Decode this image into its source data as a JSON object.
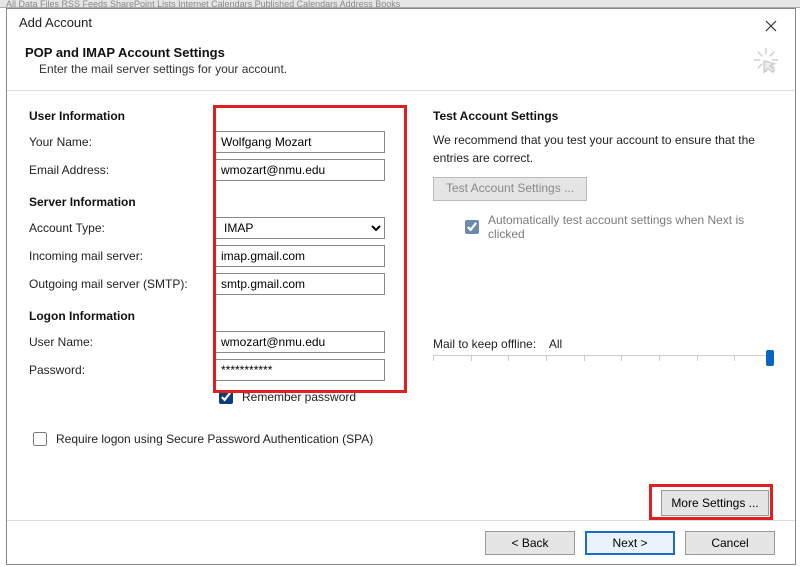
{
  "topStrip": "All   Data Files   RSS Feeds   SharePoint Lists   Internet Calendars   Published Calendars   Address Books",
  "dialog": {
    "title": "Add Account",
    "header": {
      "title": "POP and IMAP Account Settings",
      "subtitle": "Enter the mail server settings for your account."
    }
  },
  "sections": {
    "userInfo": "User Information",
    "serverInfo": "Server Information",
    "logonInfo": "Logon Information",
    "testSettings": "Test Account Settings"
  },
  "labels": {
    "yourName": "Your Name:",
    "emailAddress": "Email Address:",
    "accountType": "Account Type:",
    "incoming": "Incoming mail server:",
    "outgoing": "Outgoing mail server (SMTP):",
    "userName": "User Name:",
    "password": "Password:",
    "rememberPassword": "Remember password",
    "requireSPA": "Require logon using Secure Password Authentication (SPA)",
    "testBtn": "Test Account Settings ...",
    "autoTest": "Automatically test account settings when Next is clicked",
    "mailOffline": "Mail to keep offline:",
    "mailOfflineValue": "All",
    "moreSettings": "More Settings ..."
  },
  "values": {
    "yourName": "Wolfgang Mozart",
    "emailAddress": "wmozart@nmu.edu",
    "accountType": "IMAP",
    "incoming": "imap.gmail.com",
    "outgoing": "smtp.gmail.com",
    "userName": "wmozart@nmu.edu",
    "password": "***********",
    "rememberPassword": true,
    "requireSPA": false,
    "autoTest": true
  },
  "testDesc": "We recommend that you test your account to ensure that the entries are correct.",
  "footer": {
    "back": "< Back",
    "next": "Next >",
    "cancel": "Cancel"
  }
}
